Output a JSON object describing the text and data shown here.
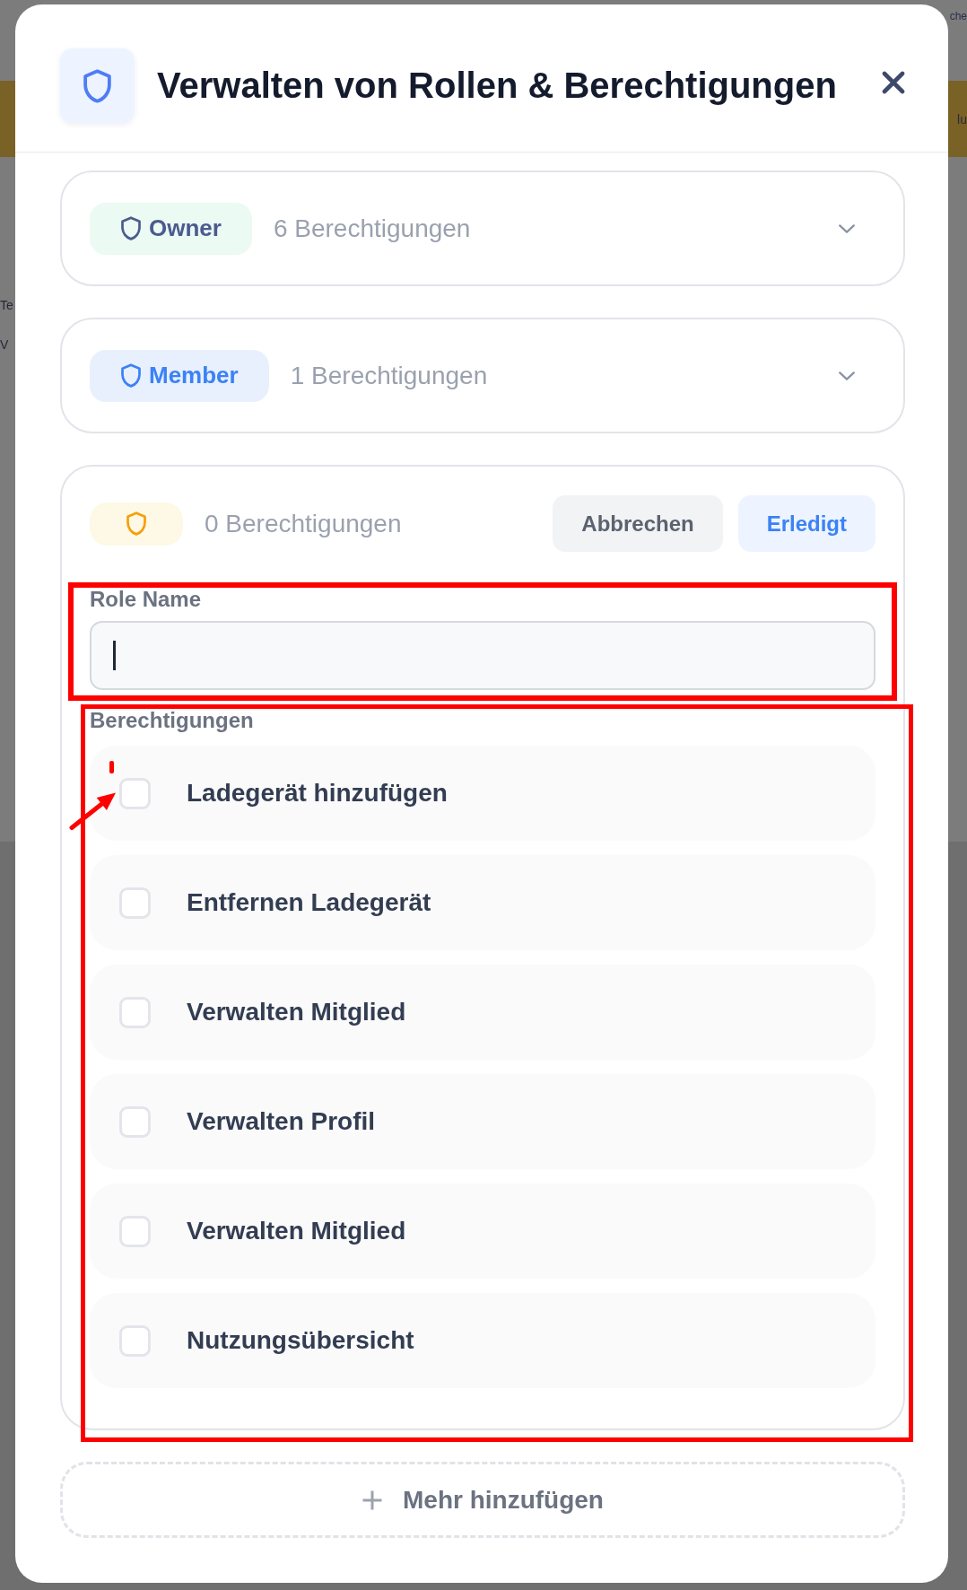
{
  "backdrop": {
    "top_right_text": "che",
    "banner_text": "lu",
    "left_texts": [
      "Te",
      "V"
    ]
  },
  "dialog": {
    "title": "Verwalten von Rollen & Berechtigungen"
  },
  "roles": [
    {
      "kind": "collapsed",
      "name": "Owner",
      "count": "6 Berechtigungen",
      "color": "#4b5b8f",
      "badge": {
        "color": "#ebfaf3"
      }
    },
    {
      "kind": "collapsed",
      "name": "Member",
      "count": "1 Berechtigungen",
      "color": "#3b82f6",
      "badge": {
        "color": "#e8f0fe"
      }
    },
    {
      "kind": "editing",
      "count": "0 Berechtigungen",
      "color": "#f5a00b",
      "badge": {
        "color": "#fef8e6"
      },
      "buttons": [
        {
          "kind": "cancel",
          "label": "Abbrechen"
        },
        {
          "kind": "confirm",
          "label": "Erledigt"
        }
      ],
      "name_field": {
        "label": "Role Name",
        "focused": true,
        "highlighted": true
      },
      "permissions": {
        "label": "Berechtigungen",
        "highlighted": true,
        "items": [
          {
            "label": "Ladegerät hinzufügen",
            "checked": false,
            "pointed": true
          },
          {
            "label": "Entfernen Ladegerät",
            "checked": false,
            "pointed": false
          },
          {
            "label": "Verwalten Mitglied",
            "checked": false,
            "pointed": false
          },
          {
            "label": "Verwalten Profil",
            "checked": false,
            "pointed": false
          },
          {
            "label": "Verwalten Mitglied",
            "checked": false,
            "pointed": false
          },
          {
            "label": "Nutzungsübersicht",
            "checked": false,
            "pointed": false
          }
        ]
      }
    }
  ],
  "add_button": {
    "label": "Mehr hinzufügen"
  }
}
